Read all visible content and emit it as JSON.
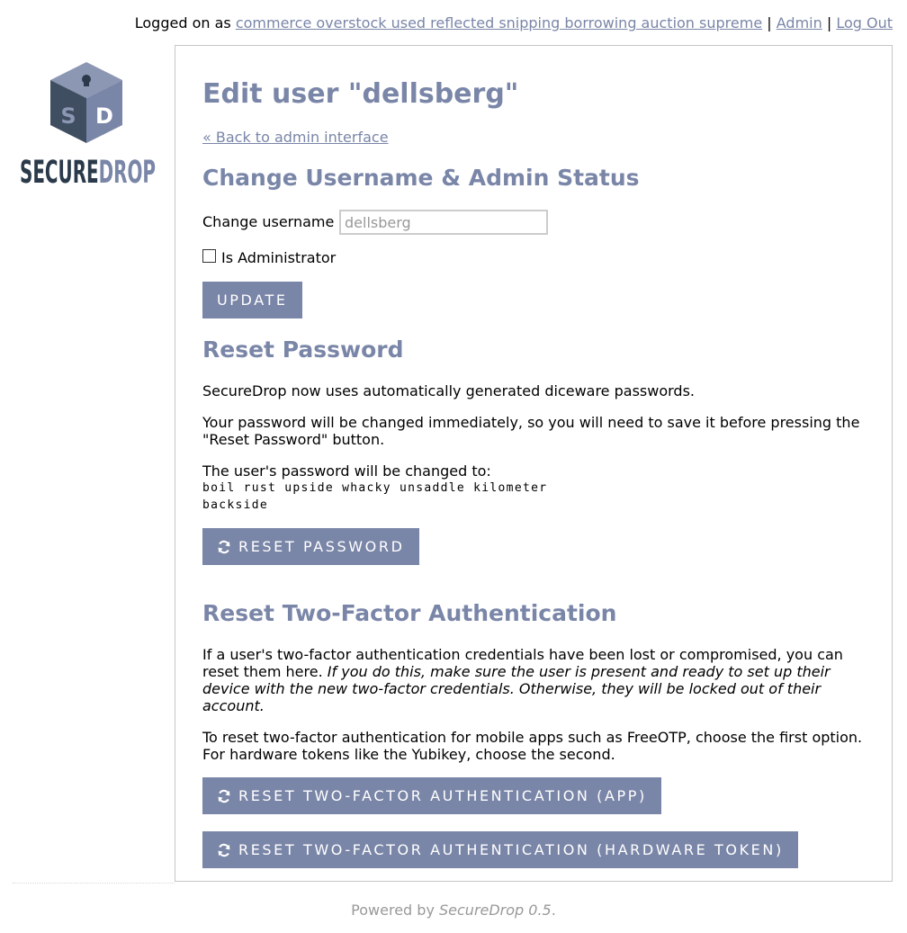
{
  "topbar": {
    "logged_on_prefix": "Logged on as",
    "username_link": "commerce overstock used reflected snipping borrowing auction supreme",
    "separator": "|",
    "admin_link": "Admin",
    "logout_link": "Log Out"
  },
  "logo": {
    "text": "SECUREDROP",
    "alt": "SecureDrop"
  },
  "page": {
    "title": "Edit user \"dellsberg\"",
    "back_link": "« Back to admin interface"
  },
  "change_username": {
    "heading": "Change Username & Admin Status",
    "label": "Change username",
    "placeholder": "dellsberg",
    "checkbox_label": "Is Administrator",
    "update_button": "UPDATE"
  },
  "reset_password": {
    "heading": "Reset Password",
    "p1": "SecureDrop now uses automatically generated diceware passwords.",
    "p2": "Your password will be changed immediately, so you will need to save it before pressing the \"Reset Password\" button.",
    "p3": "The user's password will be changed to:",
    "new_password_line1": "boil rust upside whacky unsaddle kilometer",
    "new_password_line2": "backside",
    "button": "RESET PASSWORD"
  },
  "reset_2fa": {
    "heading": "Reset Two-Factor Authentication",
    "p1_plain": "If a user's two-factor authentication credentials have been lost or compromised, you can reset them here.",
    "p1_italic": "If you do this, make sure the user is present and ready to set up their device with the new two-factor credentials. Otherwise, they will be locked out of their account.",
    "p2": "To reset two-factor authentication for mobile apps such as FreeOTP, choose the first option. For hardware tokens like the Yubikey, choose the second.",
    "button_app": "RESET TWO-FACTOR AUTHENTICATION (APP)",
    "button_hardware": "RESET TWO-FACTOR AUTHENTICATION (HARDWARE TOKEN)"
  },
  "footer": {
    "prefix": "Powered by",
    "product": "SecureDrop 0.5",
    "suffix": "."
  },
  "colors": {
    "accent": "#7a86a8",
    "logo_dark": "#2b3a4a",
    "border": "#c6c6c6"
  },
  "icons": {
    "refresh": "refresh-icon",
    "logo_cube": "securedrop-cube-logo"
  }
}
